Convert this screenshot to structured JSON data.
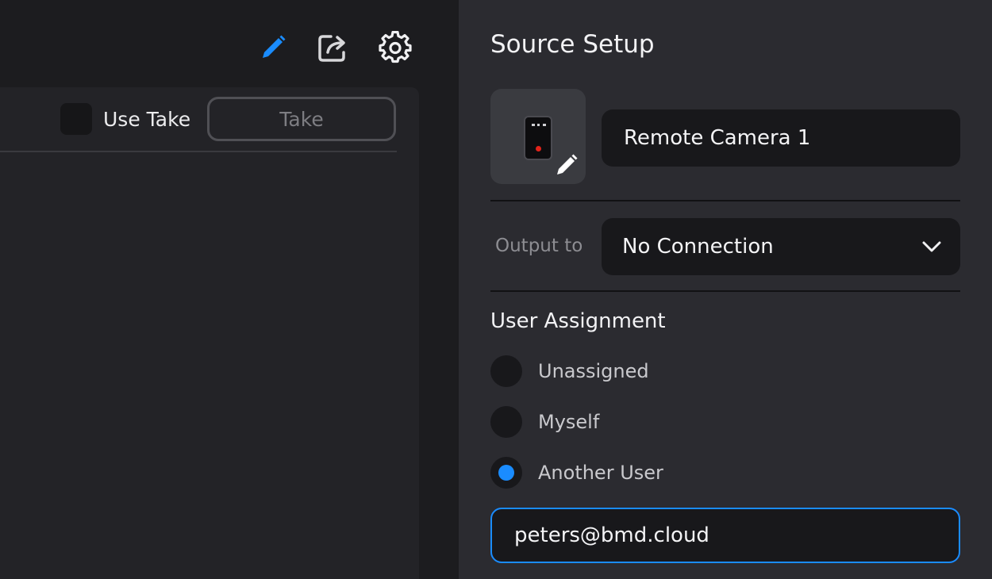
{
  "toolbar": {
    "icons": [
      "pencil-icon",
      "share-icon",
      "gear-icon"
    ],
    "accent": "#1a8cff"
  },
  "left_panel": {
    "use_take_label": "Use Take",
    "take_button_label": "Take"
  },
  "source_setup": {
    "title": "Source Setup",
    "source_name": "Remote Camera 1",
    "output_label": "Output to",
    "output_value": "No Connection",
    "user_assignment_title": "User Assignment",
    "options": [
      {
        "label": "Unassigned",
        "selected": false
      },
      {
        "label": "Myself",
        "selected": false
      },
      {
        "label": "Another User",
        "selected": true
      }
    ],
    "email_value": "peters@bmd.cloud"
  }
}
